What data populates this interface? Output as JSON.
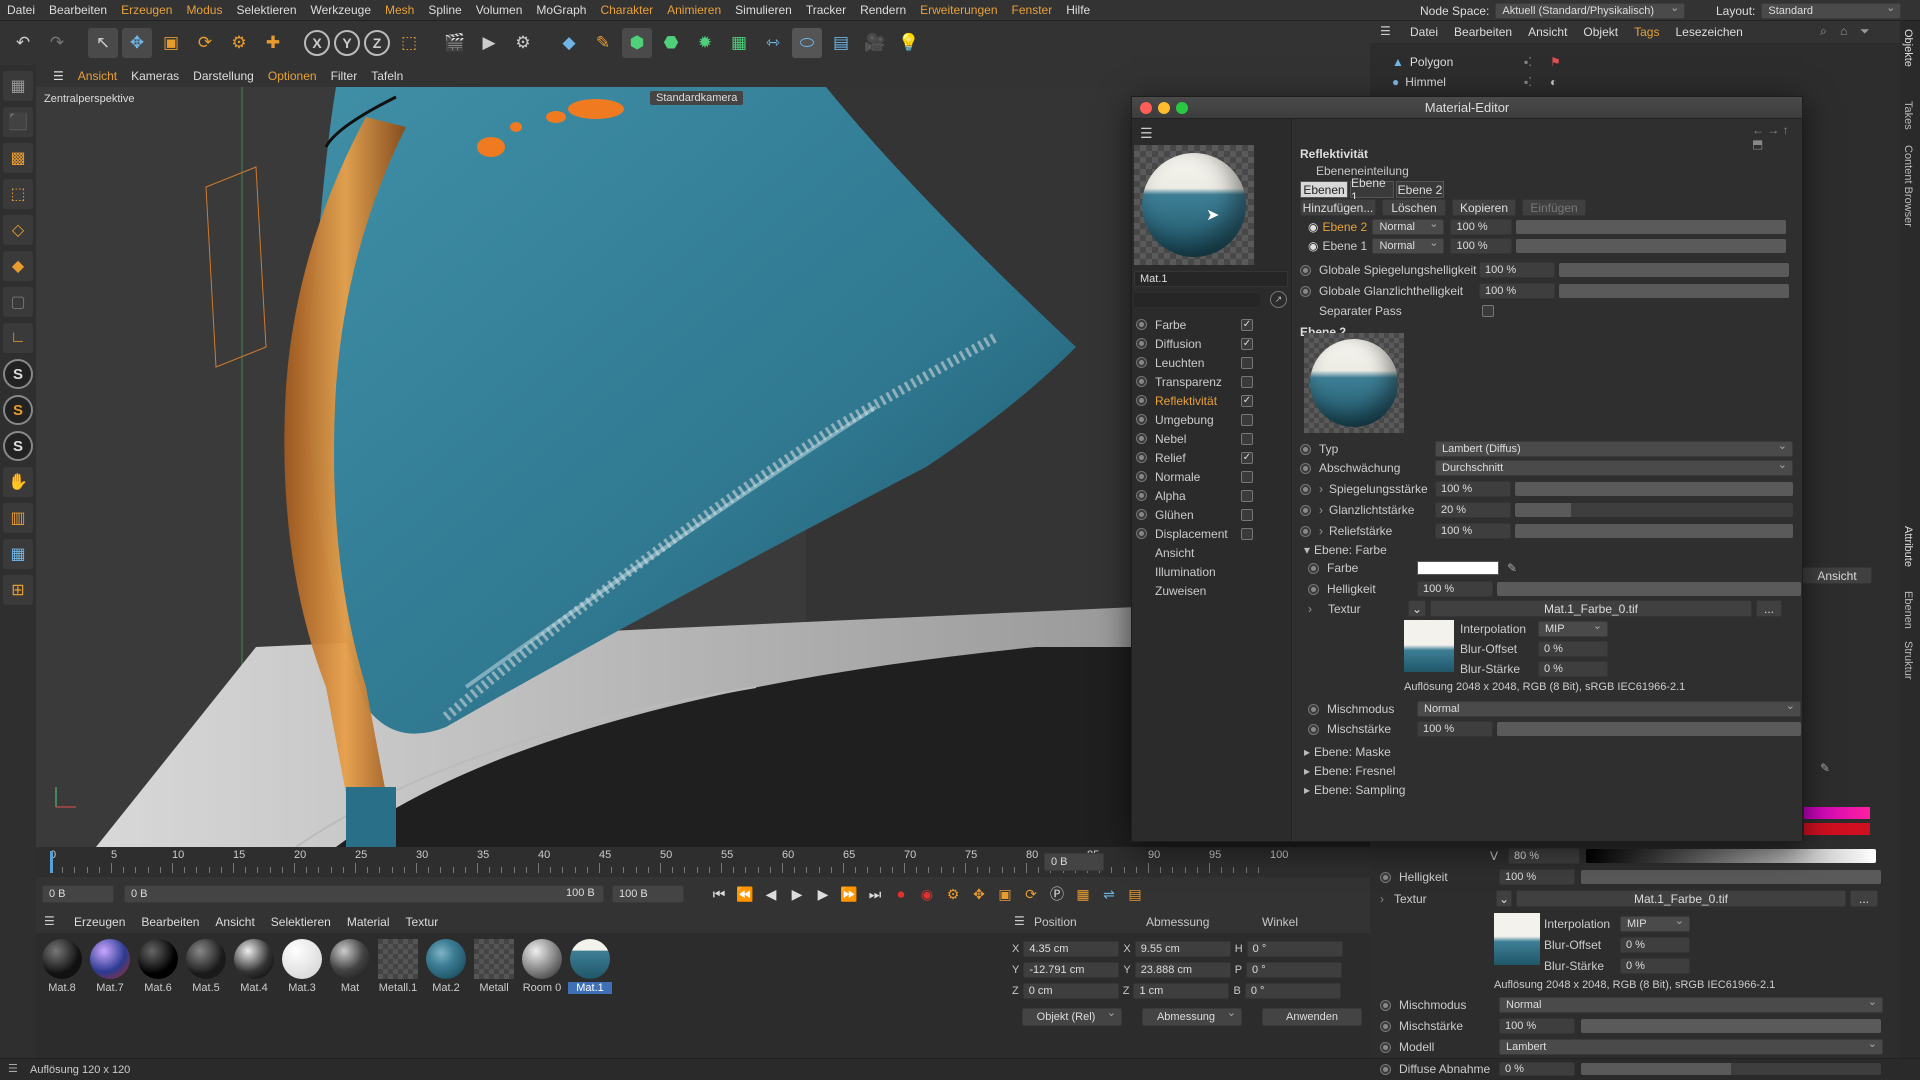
{
  "menubar": {
    "items": [
      "Datei",
      "Bearbeiten",
      "Erzeugen",
      "Modus",
      "Selektieren",
      "Werkzeuge",
      "Mesh",
      "Spline",
      "Volumen",
      "MoGraph",
      "Charakter",
      "Animieren",
      "Simulieren",
      "Tracker",
      "Rendern",
      "Erweiterungen",
      "Fenster",
      "Hilfe"
    ],
    "node_space_label": "Node Space:",
    "node_space_value": "Aktuell (Standard/Physikalisch)",
    "layout_label": "Layout:",
    "layout_value": "Standard"
  },
  "viewport": {
    "menu": [
      "Ansicht",
      "Kameras",
      "Darstellung",
      "Optionen",
      "Filter",
      "Tafeln"
    ],
    "label": "Zentralperspektive",
    "camera": "Standardkamera"
  },
  "timeline": {
    "ticks": [
      "0",
      "5",
      "10",
      "15",
      "20",
      "25",
      "30",
      "35",
      "40",
      "45",
      "50",
      "55",
      "60",
      "65",
      "70",
      "75",
      "80",
      "85",
      "90",
      "95",
      "100"
    ],
    "current_frame": "0 B",
    "start": "0 B",
    "preview_start": "0 B",
    "preview_end": "100 B",
    "end": "100 B"
  },
  "material_manager": {
    "menu": [
      "Erzeugen",
      "Bearbeiten",
      "Ansicht",
      "Selektieren",
      "Material",
      "Textur"
    ],
    "materials": [
      "Mat.8",
      "Mat.7",
      "Mat.6",
      "Mat.5",
      "Mat.4",
      "Mat.3",
      "Mat",
      "Metall.1",
      "Mat.2",
      "Metall",
      "Room 0",
      "Mat.1"
    ],
    "selected": "Mat.1"
  },
  "coordinates": {
    "headers": [
      "Position",
      "Abmessung",
      "Winkel"
    ],
    "rows": [
      {
        "axis": "X",
        "pos": "4.35 cm",
        "size_axis": "X",
        "size": "9.55 cm",
        "rot_axis": "H",
        "rot": "0 °"
      },
      {
        "axis": "Y",
        "pos": "-12.791 cm",
        "size_axis": "Y",
        "size": "23.888 cm",
        "rot_axis": "P",
        "rot": "0 °"
      },
      {
        "axis": "Z",
        "pos": "0 cm",
        "size_axis": "Z",
        "size": "1 cm",
        "rot_axis": "B",
        "rot": "0 °"
      }
    ],
    "mode": "Objekt (Rel)",
    "size_mode": "Abmessung",
    "apply": "Anwenden"
  },
  "statusbar": {
    "text": "Auflösung 120 x 120"
  },
  "object_manager": {
    "menu": [
      "Datei",
      "Bearbeiten",
      "Ansicht",
      "Objekt",
      "Tags",
      "Lesezeichen"
    ],
    "objects": [
      "Polygon",
      "Himmel"
    ]
  },
  "right_tabs": [
    "Objekte",
    "Takes",
    "Content Browser",
    "Attribute",
    "Ebenen",
    "Struktur"
  ],
  "attribute_bg": {
    "ansicht": "Ansicht",
    "v_label": "V",
    "v_value": "80 %",
    "helligkeit_label": "Helligkeit",
    "helligkeit_value": "100 %",
    "helligkeit_fill": 1.0,
    "textur_label": "Textur",
    "textur_file": "Mat.1_Farbe_0.tif",
    "interpolation_label": "Interpolation",
    "interpolation_value": "MIP",
    "bluroffset_label": "Blur-Offset",
    "bluroffset_value": "0 %",
    "blurstaerke_label": "Blur-Stärke",
    "blurstaerke_value": "0 %",
    "resolution": "Auflösung 2048 x 2048, RGB (8 Bit), sRGB IEC61966-2.1",
    "mischmodus_label": "Mischmodus",
    "mischmodus_value": "Normal",
    "mischstaerke_label": "Mischstärke",
    "mischstaerke_value": "100 %",
    "mischstaerke_fill": 1.0,
    "modell_label": "Modell",
    "modell_value": "Lambert",
    "diffuse_label": "Diffuse Abnahme",
    "diffuse_value": "0 %",
    "diffuse_fill": 0.5,
    "dots_button": "..."
  },
  "material_editor": {
    "title": "Material-Editor",
    "material_name": "Mat.1",
    "channels": [
      {
        "name": "Farbe",
        "checked": true
      },
      {
        "name": "Diffusion",
        "checked": true
      },
      {
        "name": "Leuchten",
        "checked": false
      },
      {
        "name": "Transparenz",
        "checked": false
      },
      {
        "name": "Reflektivität",
        "checked": true,
        "highlight": true
      },
      {
        "name": "Umgebung",
        "checked": false
      },
      {
        "name": "Nebel",
        "checked": false
      },
      {
        "name": "Relief",
        "checked": true
      },
      {
        "name": "Normale",
        "checked": false
      },
      {
        "name": "Alpha",
        "checked": false
      },
      {
        "name": "Glühen",
        "checked": false
      },
      {
        "name": "Displacement",
        "checked": false
      }
    ],
    "extra_sections": [
      "Ansicht",
      "Illumination",
      "Zuweisen"
    ],
    "section_title": "Reflektivität",
    "ebeneneinteilung": "Ebeneneinteilung",
    "tabs": [
      "Ebenen",
      "Ebene 1",
      "Ebene 2"
    ],
    "buttons": [
      "Hinzufügen...",
      "Löschen",
      "Kopieren",
      "Einfügen"
    ],
    "layers": [
      {
        "name": "Ebene 2",
        "mode": "Normal",
        "value": "100 %",
        "active": true
      },
      {
        "name": "Ebene 1",
        "mode": "Normal",
        "value": "100 %",
        "active": false
      }
    ],
    "global_spec_label": "Globale Spiegelungshelligkeit",
    "global_spec_value": "100 %",
    "global_gloss_label": "Globale Glanzlichthelligkeit",
    "global_gloss_value": "100 %",
    "separate_pass_label": "Separater Pass",
    "ebene2_head": "Ebene 2",
    "typ_label": "Typ",
    "typ_value": "Lambert (Diffus)",
    "abschwaechung_label": "Abschwächung",
    "abschwaechung_value": "Durchschnitt",
    "spiegel_label": "Spiegelungsstärke",
    "spiegel_value": "100 %",
    "spiegel_fill": 1.0,
    "glanz_label": "Glanzlichtstärke",
    "glanz_value": "20 %",
    "glanz_fill": 0.2,
    "relief_label": "Reliefstärke",
    "relief_value": "100 %",
    "relief_fill": 1.0,
    "farbe_section": "Ebene: Farbe",
    "farbe_label": "Farbe",
    "helligkeit_label": "Helligkeit",
    "helligkeit_value": "100 %",
    "helligkeit_fill": 1.0,
    "textur_label": "Textur",
    "textur_file": "Mat.1_Farbe_0.tif",
    "interpolation_label": "Interpolation",
    "interpolation_value": "MIP",
    "bluroffset_label": "Blur-Offset",
    "bluroffset_value": "0 %",
    "blurstaerke_label": "Blur-Stärke",
    "blurstaerke_value": "0 %",
    "resolution": "Auflösung 2048 x 2048, RGB (8 Bit), sRGB IEC61966-2.1",
    "mischmodus_label": "Mischmodus",
    "mischmodus_value": "Normal",
    "mischstaerke_label": "Mischstärke",
    "mischstaerke_value": "100 %",
    "mischstaerke_fill": 1.0,
    "sections_collapsed": [
      "Ebene: Maske",
      "Ebene: Fresnel",
      "Ebene: Sampling"
    ],
    "dots_button": "..."
  }
}
